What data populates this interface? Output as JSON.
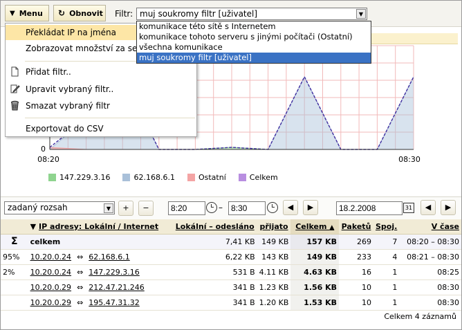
{
  "toolbar": {
    "menu_label": "Menu",
    "refresh_label": "Obnovit",
    "filter_label": "Filtr:",
    "filter_value": "muj soukromy filtr [uživatel]"
  },
  "filter_options": [
    "komunikace této sítě s Internetem",
    "komunikace tohoto serveru s jinými počítači (Ostatní)",
    "všechna komunikace",
    "muj soukromy filtr [uživatel]"
  ],
  "menu": {
    "translate_ip": "Překládat IP na jména",
    "show_amount": "Zobrazovat množství za sekundu",
    "add_filter": "Přidat filtr..",
    "edit_filter": "Upravit vybraný filtr..",
    "delete_filter": "Smazat vybraný filtr",
    "export_csv": "Exportovat do CSV"
  },
  "chart_data": {
    "type": "area",
    "x": [
      "08:20",
      "08:21",
      "08:22",
      "08:23",
      "08:24",
      "08:25",
      "08:26",
      "08:27",
      "08:28",
      "08:29",
      "08:30"
    ],
    "xticks": [
      "08:20",
      "08:30"
    ],
    "ytick_zero": "0",
    "series": [
      {
        "name": "147.229.3.16",
        "color": "#8fd48f",
        "values": [
          0,
          0,
          0,
          0,
          0,
          2,
          0,
          0,
          0,
          0,
          0
        ]
      },
      {
        "name": "62.168.6.1",
        "color": "#a9c0d9",
        "values": [
          0,
          30,
          70,
          0,
          0,
          0,
          0,
          70,
          0,
          0,
          70
        ]
      },
      {
        "name": "Ostatní",
        "color": "#f4a4a4",
        "values": [
          2,
          0,
          0,
          0,
          0,
          0,
          0,
          0,
          0,
          0,
          0
        ]
      },
      {
        "name": "Celkem",
        "color": "#b88ee0",
        "values": [
          2,
          30,
          70,
          0,
          0,
          2,
          0,
          70,
          0,
          0,
          70
        ]
      }
    ],
    "ylim": [
      0,
      100
    ]
  },
  "controls": {
    "range_label": "zadaný rozsah",
    "time_from": "8:20",
    "time_to": "8:30",
    "date": "18.2.2008",
    "zoom_in": "+",
    "zoom_out": "−",
    "prev": "◀",
    "next": "▶",
    "calendar": "31"
  },
  "table": {
    "headers": {
      "ip": "IP adresy: Lokální / Internet",
      "sent": "Lokální – odesláno",
      "received": "přijato",
      "total": "Celkem",
      "packets": "Paketů",
      "conn": "Spoj.",
      "time": "V čase"
    },
    "total_row": {
      "label": "celkem",
      "sent": "7,41 KB",
      "received": "149 KB",
      "total": "157 KB",
      "packets": "269",
      "conn": "7",
      "time": "08:20 – 08:30"
    },
    "rows": [
      {
        "pct": "95%",
        "local": "10.20.0.24",
        "arrow": "⇔",
        "remote": "62.168.6.1",
        "sent": "6,22 KB",
        "received": "143 KB",
        "total": "149 KB",
        "packets": "233",
        "conn": "4",
        "time": "08:21 – 08:30"
      },
      {
        "pct": "2%",
        "local": "10.20.0.24",
        "arrow": "⇔",
        "remote": "147.229.3.16",
        "sent": "531 B",
        "received": "4.11 KB",
        "total": "4.63 KB",
        "packets": "16",
        "conn": "1",
        "time": "08:25"
      },
      {
        "pct": "",
        "local": "10.20.0.29",
        "arrow": "⇔",
        "remote": "212.47.21.246",
        "sent": "341 B",
        "received": "1.23 KB",
        "total": "1.56 KB",
        "packets": "10",
        "conn": "1",
        "time": "08:30"
      },
      {
        "pct": "",
        "local": "10.20.0.29",
        "arrow": "⇔",
        "remote": "195.47.31.32",
        "sent": "341 B",
        "received": "1.20 KB",
        "total": "1.53 KB",
        "packets": "10",
        "conn": "1",
        "time": "08:30"
      }
    ],
    "footer": "Celkem 4 záznamů"
  },
  "colors": {
    "highlight": "#fde6a6",
    "select_blue": "#3a72c4",
    "toolbar_bg": "#f4f3ee"
  }
}
